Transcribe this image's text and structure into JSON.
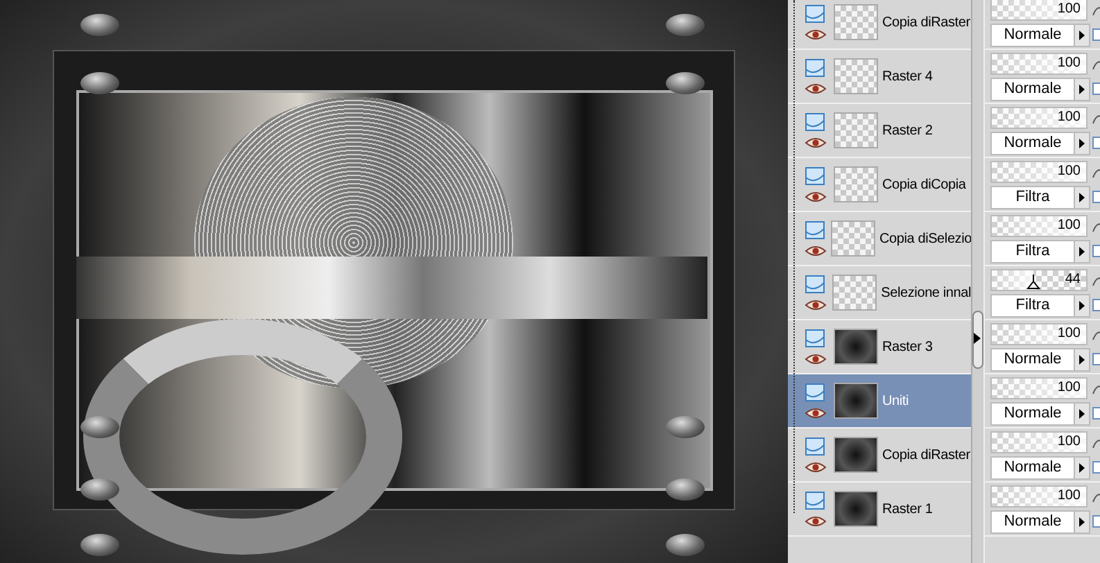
{
  "layers": [
    {
      "name": "Copia diRaster",
      "selected": false,
      "visible": true,
      "kind": "transparent",
      "opacity": {
        "level": 1,
        "reading": "100"
      },
      "blend_mode": "Normale"
    },
    {
      "name": "Raster 4",
      "selected": false,
      "visible": true,
      "kind": "transparent",
      "opacity": {
        "level": 1,
        "reading": "100"
      },
      "blend_mode": "Normale"
    },
    {
      "name": "Raster 2",
      "selected": false,
      "visible": true,
      "kind": "transparent",
      "opacity": {
        "level": 1,
        "reading": "100"
      },
      "blend_mode": "Normale"
    },
    {
      "name": "Copia diCopia",
      "selected": false,
      "visible": true,
      "kind": "transparent",
      "opacity": {
        "level": 1,
        "reading": "100"
      },
      "blend_mode": "Filtra"
    },
    {
      "name": "Copia diSelezio",
      "selected": false,
      "visible": true,
      "kind": "transparent",
      "opacity": {
        "level": 1,
        "reading": "100"
      },
      "blend_mode": "Filtra"
    },
    {
      "name": "Selezione innal",
      "selected": false,
      "visible": true,
      "kind": "transparent",
      "opacity": {
        "level": 0.44,
        "reading": "44"
      },
      "blend_mode": "Filtra"
    },
    {
      "name": "Raster 3",
      "selected": false,
      "visible": true,
      "kind": "dark",
      "opacity": {
        "level": 1,
        "reading": "100"
      },
      "blend_mode": "Normale"
    },
    {
      "name": "Uniti",
      "selected": true,
      "visible": true,
      "kind": "dark",
      "opacity": {
        "level": 1,
        "reading": "100"
      },
      "blend_mode": "Normale"
    },
    {
      "name": "Copia diRaster",
      "selected": false,
      "visible": true,
      "kind": "dark",
      "opacity": {
        "level": 1,
        "reading": "100"
      },
      "blend_mode": "Normale"
    },
    {
      "name": "Raster 1",
      "selected": false,
      "visible": true,
      "kind": "dark",
      "opacity": {
        "level": 1,
        "reading": "100"
      },
      "blend_mode": "Normale"
    }
  ]
}
